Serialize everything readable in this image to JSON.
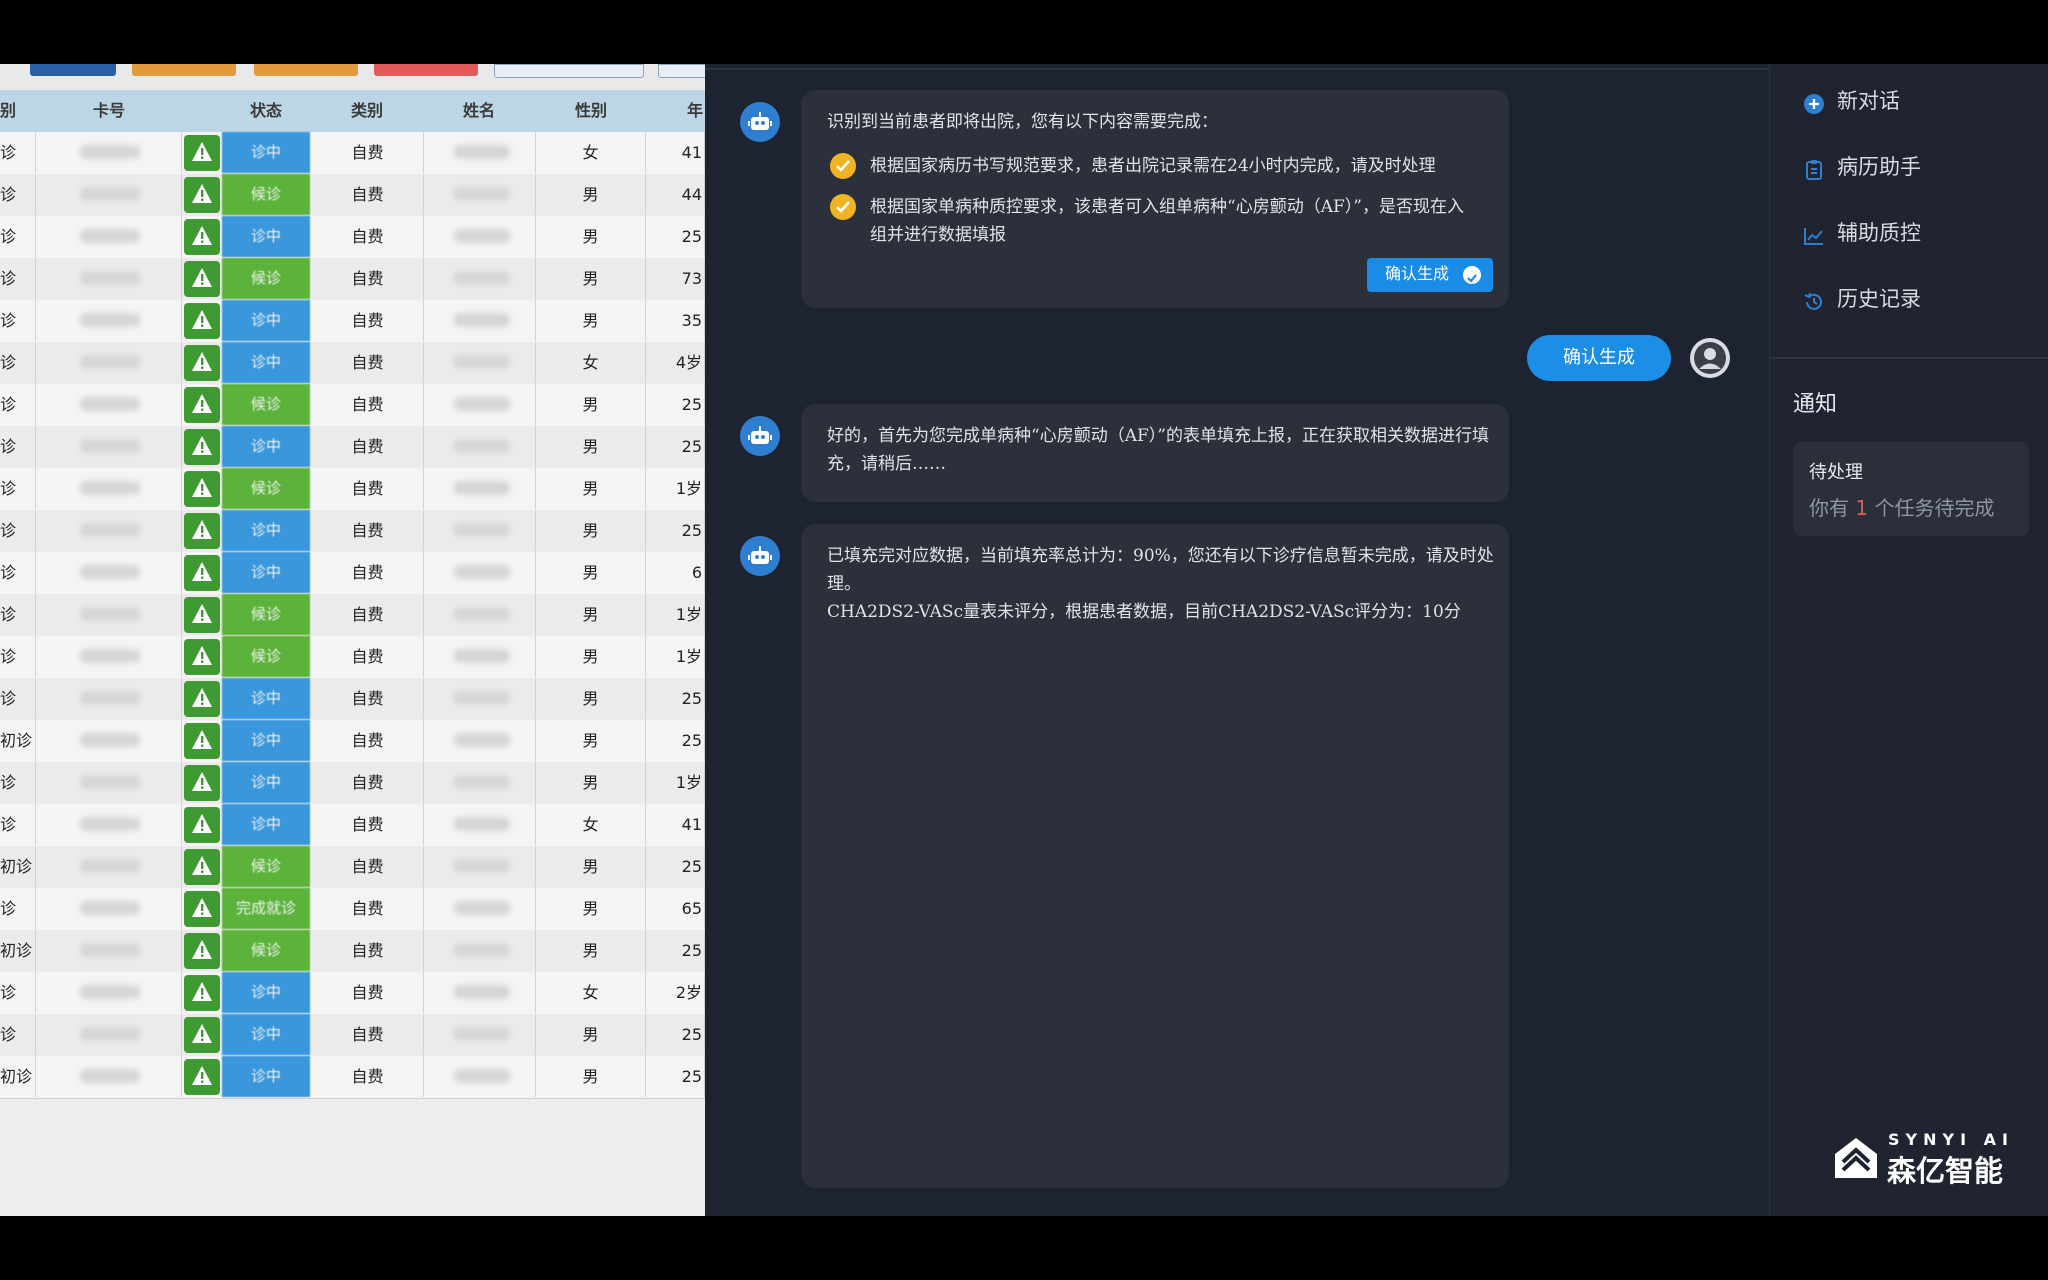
{
  "table": {
    "headers": [
      "别",
      "卡号",
      "状态",
      "类别",
      "姓名",
      "性别",
      "年"
    ],
    "top_buttons": [
      {
        "color": "#2a5fa8"
      },
      {
        "color": "#e39a3a"
      },
      {
        "color": "#e39a3a"
      },
      {
        "color": "#e25a5a"
      },
      {
        "color": "#e9eef4"
      },
      {
        "color": "#e9eef4"
      }
    ],
    "rows": [
      {
        "visit": "诊",
        "status": "诊中",
        "type": "自费",
        "sex": "女",
        "age": "41"
      },
      {
        "visit": "诊",
        "status": "候诊",
        "type": "自费",
        "sex": "男",
        "age": "44"
      },
      {
        "visit": "诊",
        "status": "诊中",
        "type": "自费",
        "sex": "男",
        "age": "25"
      },
      {
        "visit": "诊",
        "status": "候诊",
        "type": "自费",
        "sex": "男",
        "age": "73"
      },
      {
        "visit": "诊",
        "status": "诊中",
        "type": "自费",
        "sex": "男",
        "age": "35"
      },
      {
        "visit": "诊",
        "status": "诊中",
        "type": "自费",
        "sex": "女",
        "age": "4岁"
      },
      {
        "visit": "诊",
        "status": "候诊",
        "type": "自费",
        "sex": "男",
        "age": "25"
      },
      {
        "visit": "诊",
        "status": "诊中",
        "type": "自费",
        "sex": "男",
        "age": "25"
      },
      {
        "visit": "诊",
        "status": "候诊",
        "type": "自费",
        "sex": "男",
        "age": "1岁"
      },
      {
        "visit": "诊",
        "status": "诊中",
        "type": "自费",
        "sex": "男",
        "age": "25"
      },
      {
        "visit": "诊",
        "status": "诊中",
        "type": "自费",
        "sex": "男",
        "age": "6"
      },
      {
        "visit": "诊",
        "status": "候诊",
        "type": "自费",
        "sex": "男",
        "age": "1岁"
      },
      {
        "visit": "诊",
        "status": "候诊",
        "type": "自费",
        "sex": "男",
        "age": "1岁"
      },
      {
        "visit": "诊",
        "status": "诊中",
        "type": "自费",
        "sex": "男",
        "age": "25"
      },
      {
        "visit": "初诊",
        "status": "诊中",
        "type": "自费",
        "sex": "男",
        "age": "25"
      },
      {
        "visit": "诊",
        "status": "诊中",
        "type": "自费",
        "sex": "男",
        "age": "1岁"
      },
      {
        "visit": "诊",
        "status": "诊中",
        "type": "自费",
        "sex": "女",
        "age": "41"
      },
      {
        "visit": "初诊",
        "status": "候诊",
        "type": "自费",
        "sex": "男",
        "age": "25"
      },
      {
        "visit": "诊",
        "status": "完成就诊",
        "type": "自费",
        "sex": "男",
        "age": "65"
      },
      {
        "visit": "初诊",
        "status": "候诊",
        "type": "自费",
        "sex": "男",
        "age": "25"
      },
      {
        "visit": "诊",
        "status": "诊中",
        "type": "自费",
        "sex": "女",
        "age": "2岁"
      },
      {
        "visit": "诊",
        "status": "诊中",
        "type": "自费",
        "sex": "男",
        "age": "25"
      },
      {
        "visit": "初诊",
        "status": "诊中",
        "type": "自费",
        "sex": "男",
        "age": "25"
      }
    ],
    "status_colors": {
      "诊中": "#3a97dc",
      "候诊": "#5cb33b",
      "完成就诊": "#5cb33b"
    }
  },
  "chat": {
    "msg1": {
      "intro": "识别到当前患者即将出院，您有以下内容需要完成：",
      "item1": "根据国家病历书写规范要求，患者出院记录需在24小时内完成，请及时处理",
      "item2": "根据国家单病种质控要求，该患者可入组单病种“心房颤动（AF）”，是否现在入组并进行数据填报",
      "button": "确认生成"
    },
    "user_reply": "确认生成",
    "msg2": "好的，首先为您完成单病种“心房颤动（AF）”的表单填充上报，正在获取相关数据进行填充，请稍后……",
    "msg3_line1": "已填充完对应数据，当前填充率总计为：90%，您还有以下诊疗信息暂未完成，请及时处理。",
    "msg3_line2": "CHA2DS2-VASc量表未评分，根据患者数据，目前CHA2DS2-VASc评分为：10分"
  },
  "sidebar": {
    "items": [
      {
        "label": "新对话",
        "icon": "plus-circle-icon"
      },
      {
        "label": "病历助手",
        "icon": "clipboard-icon"
      },
      {
        "label": "辅助质控",
        "icon": "line-chart-icon"
      },
      {
        "label": "历史记录",
        "icon": "history-icon"
      }
    ],
    "notice_title": "通知",
    "notice_card_title": "待处理",
    "notice_prefix": "你有",
    "notice_count": "1",
    "notice_suffix": "个任务待完成"
  },
  "logo": {
    "en": "SYNYI AI",
    "cn": "森亿智能"
  },
  "colors": {
    "accent": "#1a8ce8",
    "check": "#f0b323",
    "chat_bg": "#1d2330",
    "bubble_bg": "#2b303b"
  }
}
